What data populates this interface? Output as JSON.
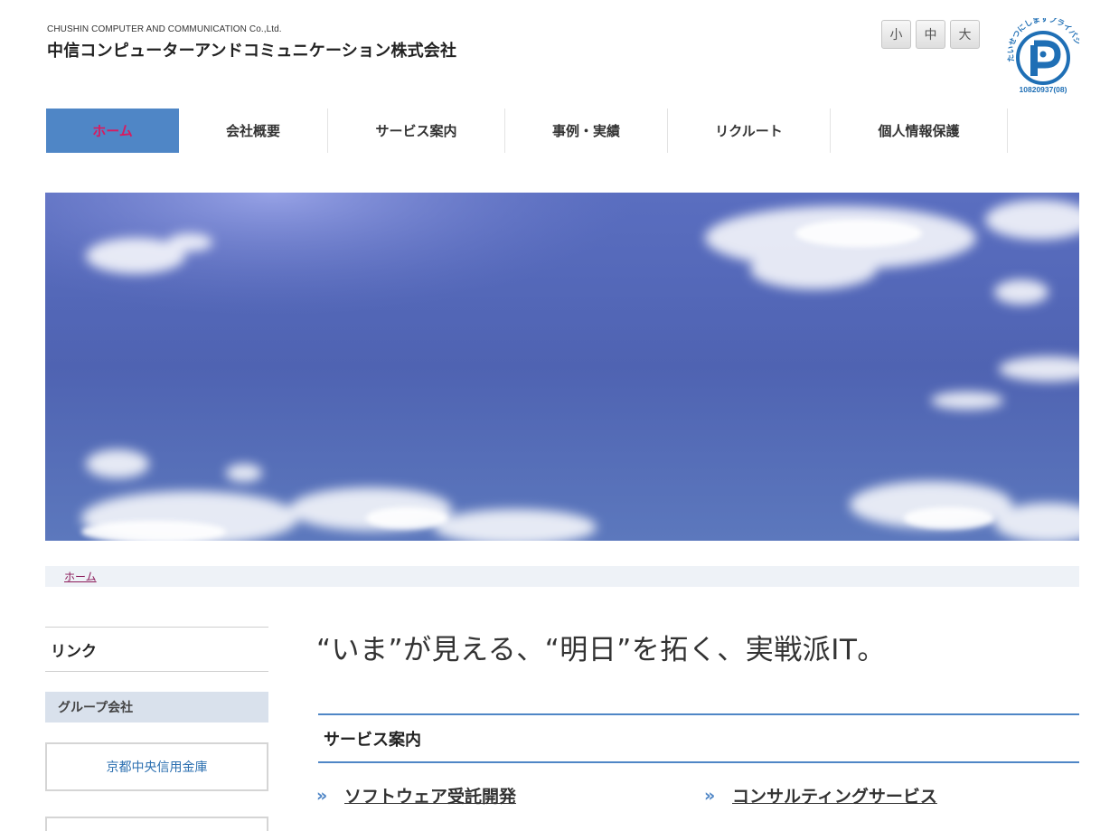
{
  "header": {
    "logo_en": "CHUSHIN COMPUTER AND COMMUNICATION Co.,Ltd.",
    "logo_ja": "中信コンピューターアンドコミュニケーション株式会社",
    "font_sizes": [
      "小",
      "中",
      "大"
    ],
    "privacy_mark": {
      "arc_text": "たいせつにしますプライバシー",
      "number": "10820937(08)"
    }
  },
  "nav": {
    "items": [
      {
        "label": "ホーム",
        "active": true
      },
      {
        "label": "会社概要",
        "active": false
      },
      {
        "label": "サービス案内",
        "active": false
      },
      {
        "label": "事例・実績",
        "active": false
      },
      {
        "label": "リクルート",
        "active": false
      },
      {
        "label": "個人情報保護",
        "active": false
      }
    ]
  },
  "breadcrumb": {
    "home": "ホーム"
  },
  "sidebar": {
    "title": "リンク",
    "group_heading": "グループ会社",
    "links": [
      "京都中央信用金庫"
    ]
  },
  "main": {
    "catchphrase": "“いま”が見える、“明日”を拓く、実戦派IT。",
    "section_title": "サービス案内",
    "services": [
      {
        "mark": "»",
        "label": "ソフトウェア受託開発"
      },
      {
        "mark": "»",
        "label": "コンサルティングサービス"
      }
    ]
  },
  "colors": {
    "accent": "#4f86c6",
    "nav_active_text": "#d81b60",
    "breadcrumb_bg": "#eef2f7",
    "sidebar_sub_bg": "#d9e1ec",
    "link": "#2b6fb0"
  }
}
